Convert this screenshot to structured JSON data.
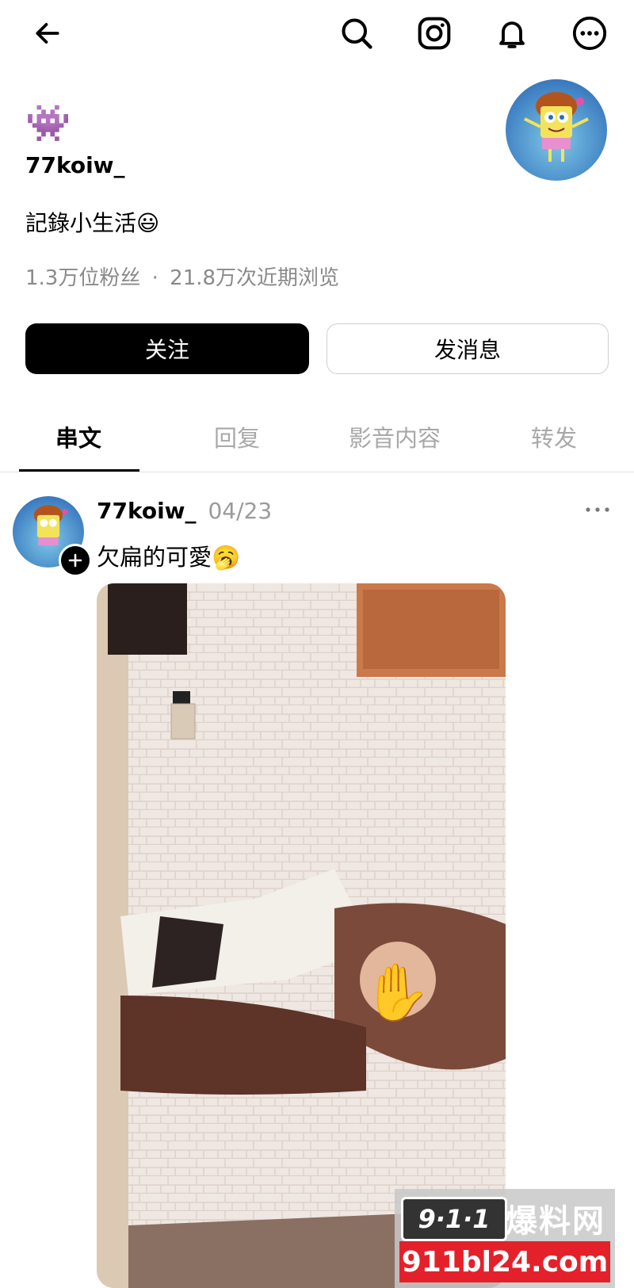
{
  "header": {
    "back_icon": "arrow-left-icon",
    "icons": [
      "search-icon",
      "instagram-icon",
      "bell-icon",
      "more-icon"
    ]
  },
  "profile": {
    "badge_emoji": "👾",
    "username": "77koiw_",
    "bio_text": "記錄小生活",
    "bio_emoji": "😃",
    "followers": "1.3万位粉丝",
    "separator": "·",
    "views": "21.8万次近期浏览",
    "avatar_desc": "spongebob-avatar"
  },
  "actions": {
    "follow_label": "关注",
    "message_label": "发消息"
  },
  "tabs": [
    {
      "label": "串文",
      "active": true
    },
    {
      "label": "回复",
      "active": false
    },
    {
      "label": "影音内容",
      "active": false
    },
    {
      "label": "转发",
      "active": false
    }
  ],
  "post": {
    "username": "77koiw_",
    "date": "04/23",
    "text": "欠扁的可愛",
    "text_emoji": "🥱",
    "more_icon": "more-horizontal-icon",
    "plus_icon": "plus-icon"
  },
  "watermark": {
    "logo_digits": "9·1·1",
    "logo_text": "爆料网",
    "url": "911bl24.com"
  },
  "colors": {
    "accent": "#000000",
    "muted": "#8a8a8a",
    "tab_inactive": "#a8a8a8",
    "watermark_red": "#e4212b"
  }
}
